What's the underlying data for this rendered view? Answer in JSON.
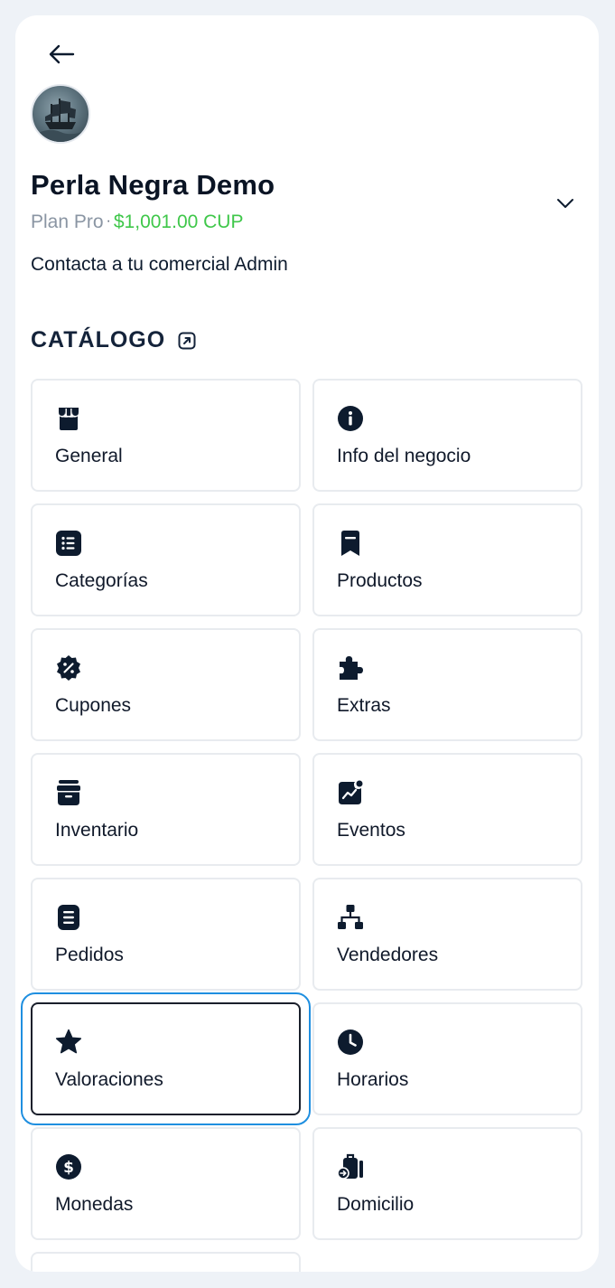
{
  "business": {
    "name": "Perla Negra Demo",
    "plan": "Plan Pro",
    "separator": "·",
    "price": "$1,001.00 CUP",
    "contact": "Contacta a tu comercial Admin"
  },
  "section": {
    "title": "CATÁLOGO"
  },
  "colors": {
    "accent_focus": "#1f8fe0",
    "price_green": "#3fc74a",
    "icon_dark": "#0d1b2e"
  },
  "cards": [
    {
      "label": "General",
      "icon": "store-icon"
    },
    {
      "label": "Info del negocio",
      "icon": "info-icon"
    },
    {
      "label": "Categorías",
      "icon": "list-icon"
    },
    {
      "label": "Productos",
      "icon": "bookmark-icon"
    },
    {
      "label": "Cupones",
      "icon": "discount-badge-icon"
    },
    {
      "label": "Extras",
      "icon": "puzzle-icon"
    },
    {
      "label": "Inventario",
      "icon": "archive-icon"
    },
    {
      "label": "Eventos",
      "icon": "chart-event-icon"
    },
    {
      "label": "Pedidos",
      "icon": "document-icon"
    },
    {
      "label": "Vendedores",
      "icon": "org-chart-icon"
    },
    {
      "label": "Valoraciones",
      "icon": "star-icon",
      "selected": true
    },
    {
      "label": "Horarios",
      "icon": "clock-icon"
    },
    {
      "label": "Monedas",
      "icon": "dollar-icon"
    },
    {
      "label": "Domicilio",
      "icon": "luggage-icon"
    }
  ]
}
